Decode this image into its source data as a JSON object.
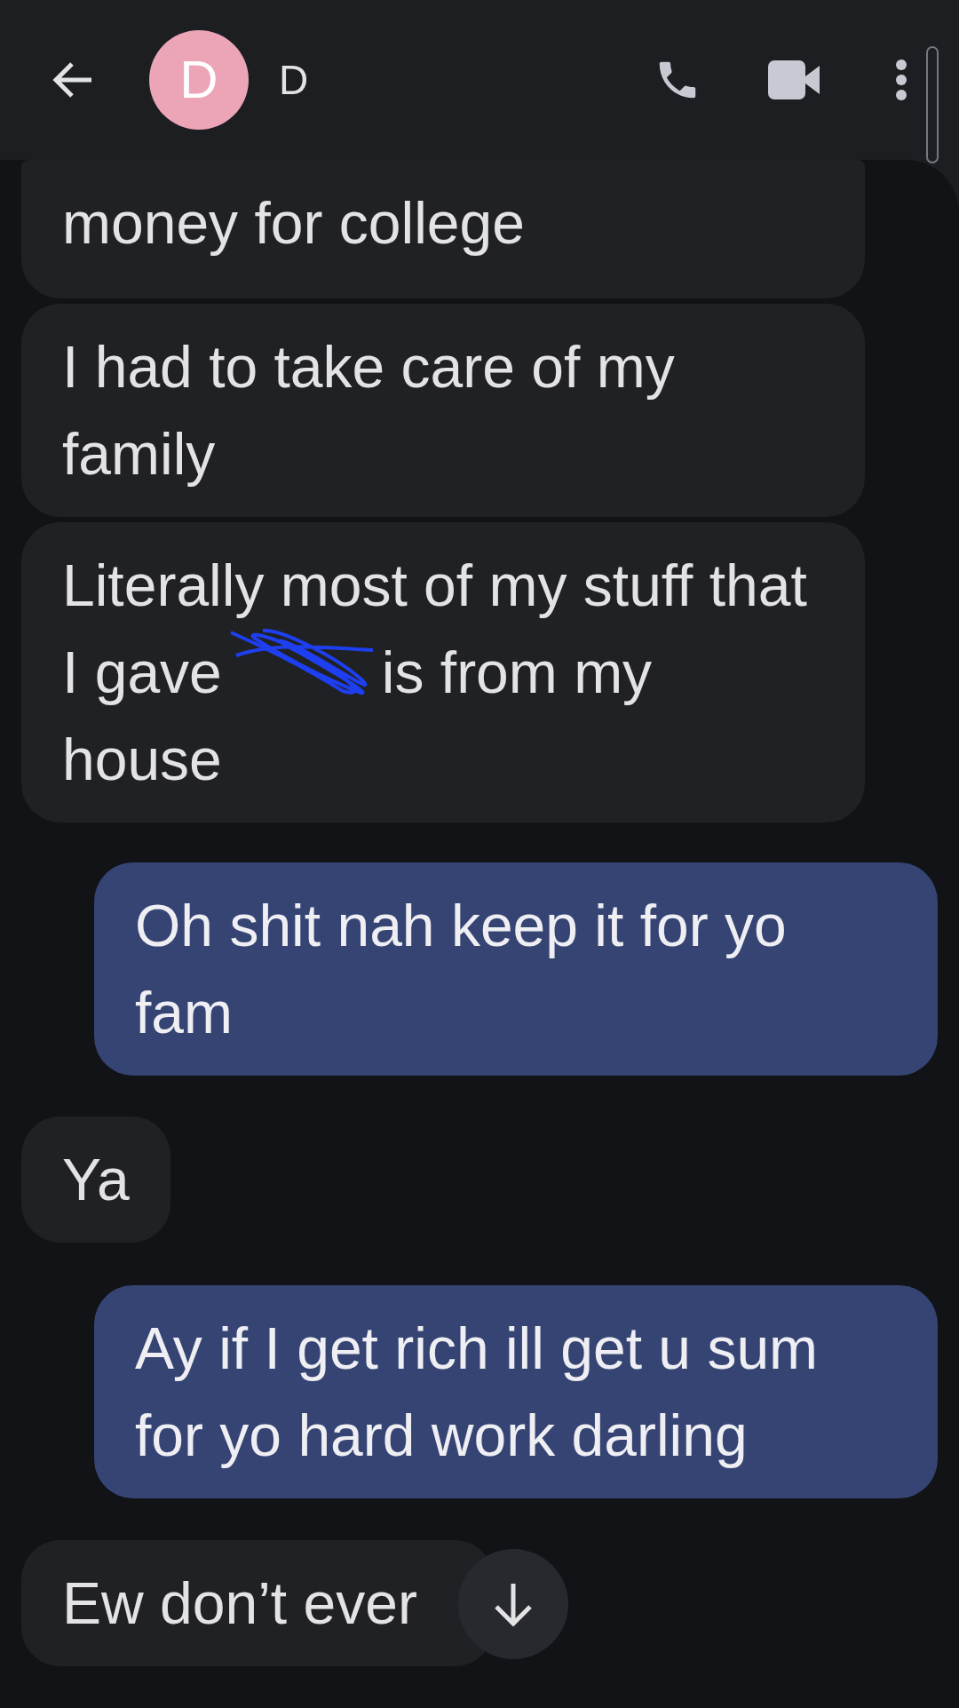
{
  "header": {
    "avatar_letter": "D",
    "contact_name": "D"
  },
  "messages": [
    {
      "kind": "received",
      "text": "money for college"
    },
    {
      "kind": "received",
      "text": "I had to take care of my family"
    },
    {
      "kind": "received",
      "text": "Literally most of my stuff that I gave",
      "text_after": "is from my house",
      "redacted": true
    },
    {
      "kind": "sent",
      "text": "Oh shit nah keep it for yo fam"
    },
    {
      "kind": "received",
      "text": "Ya"
    },
    {
      "kind": "sent",
      "text": "Ay if I get rich ill get u sum for yo hard work darling"
    },
    {
      "kind": "received",
      "text": "Ew don’t ever"
    }
  ]
}
